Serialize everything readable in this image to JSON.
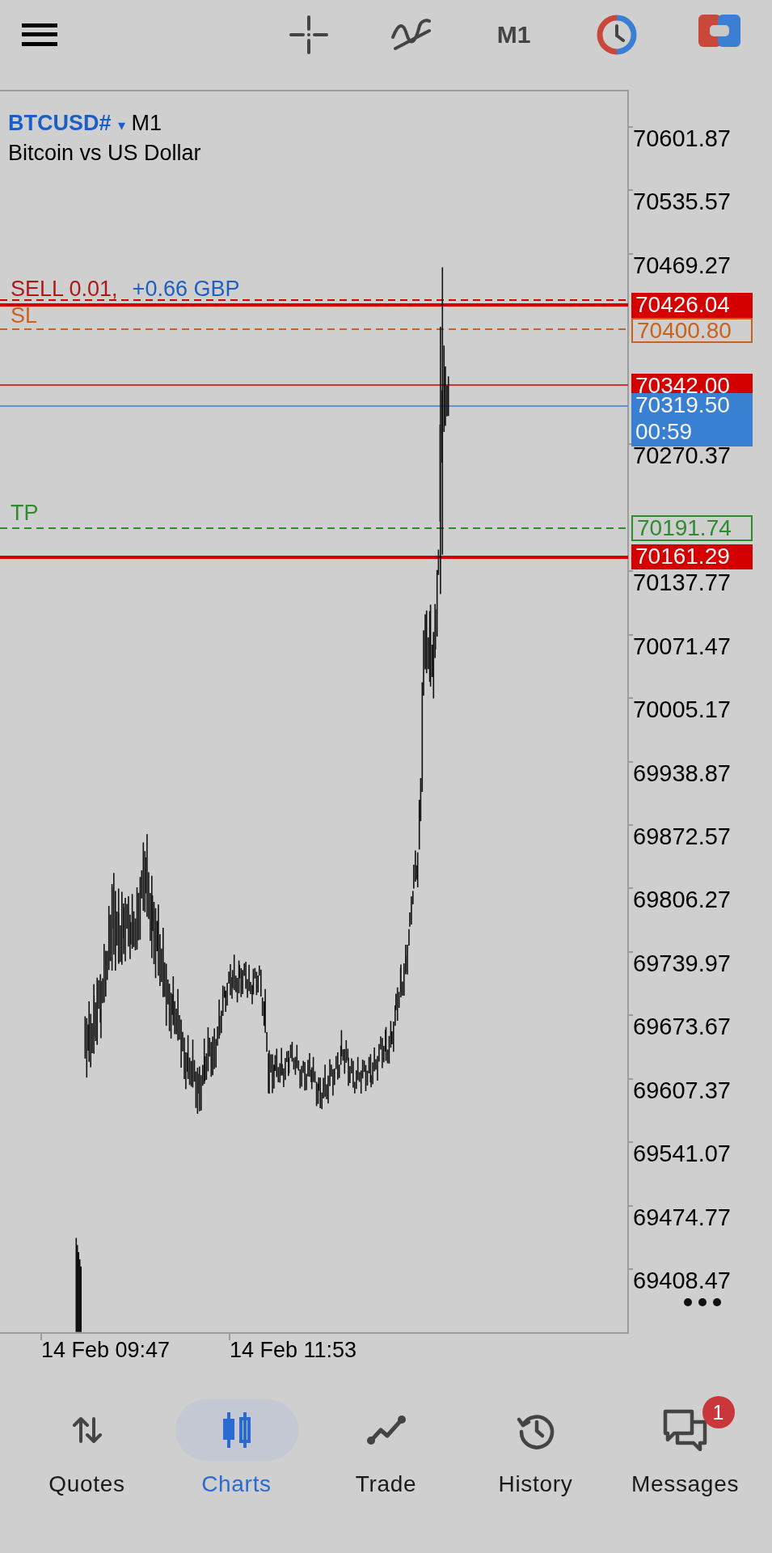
{
  "toolbar": {
    "timeframe": "M1"
  },
  "chart": {
    "symbol": "BTCUSD#",
    "symbol_caret": "▾",
    "period": "M1",
    "description": "Bitcoin vs US Dollar",
    "order_label": {
      "side": "SELL 0.01,",
      "profit": "+0.66 GBP"
    },
    "price_axis": [
      "70601.87",
      "70535.57",
      "70469.27",
      "70270.37",
      "70137.77",
      "70071.47",
      "70005.17",
      "69938.87",
      "69872.57",
      "69806.27",
      "69739.97",
      "69673.67",
      "69607.37",
      "69541.07",
      "69474.77",
      "69408.47"
    ],
    "price_lines": [
      {
        "kind": "order",
        "label": "70426.04",
        "color": "#d40000"
      },
      {
        "kind": "stop_loss",
        "tag": "SL",
        "label": "70400.80",
        "color": "#c8621e"
      },
      {
        "kind": "ask",
        "label": "70342.00",
        "color": "#d40000"
      },
      {
        "kind": "bid",
        "label": "70319.50",
        "timer": "00:59",
        "color": "#3a80d2"
      },
      {
        "kind": "take_profit",
        "tag": "TP",
        "label": "70191.74",
        "color": "#2e8b2e"
      },
      {
        "kind": "level",
        "label": "70161.29",
        "color": "#d40000"
      }
    ],
    "time_axis": [
      "14 Feb 09:47",
      "14 Feb 11:53"
    ]
  },
  "nav": [
    {
      "label": "Quotes",
      "selected": false
    },
    {
      "label": "Charts",
      "selected": true
    },
    {
      "label": "Trade",
      "selected": false
    },
    {
      "label": "History",
      "selected": false
    },
    {
      "label": "Messages",
      "selected": false,
      "badge": "1"
    }
  ]
}
